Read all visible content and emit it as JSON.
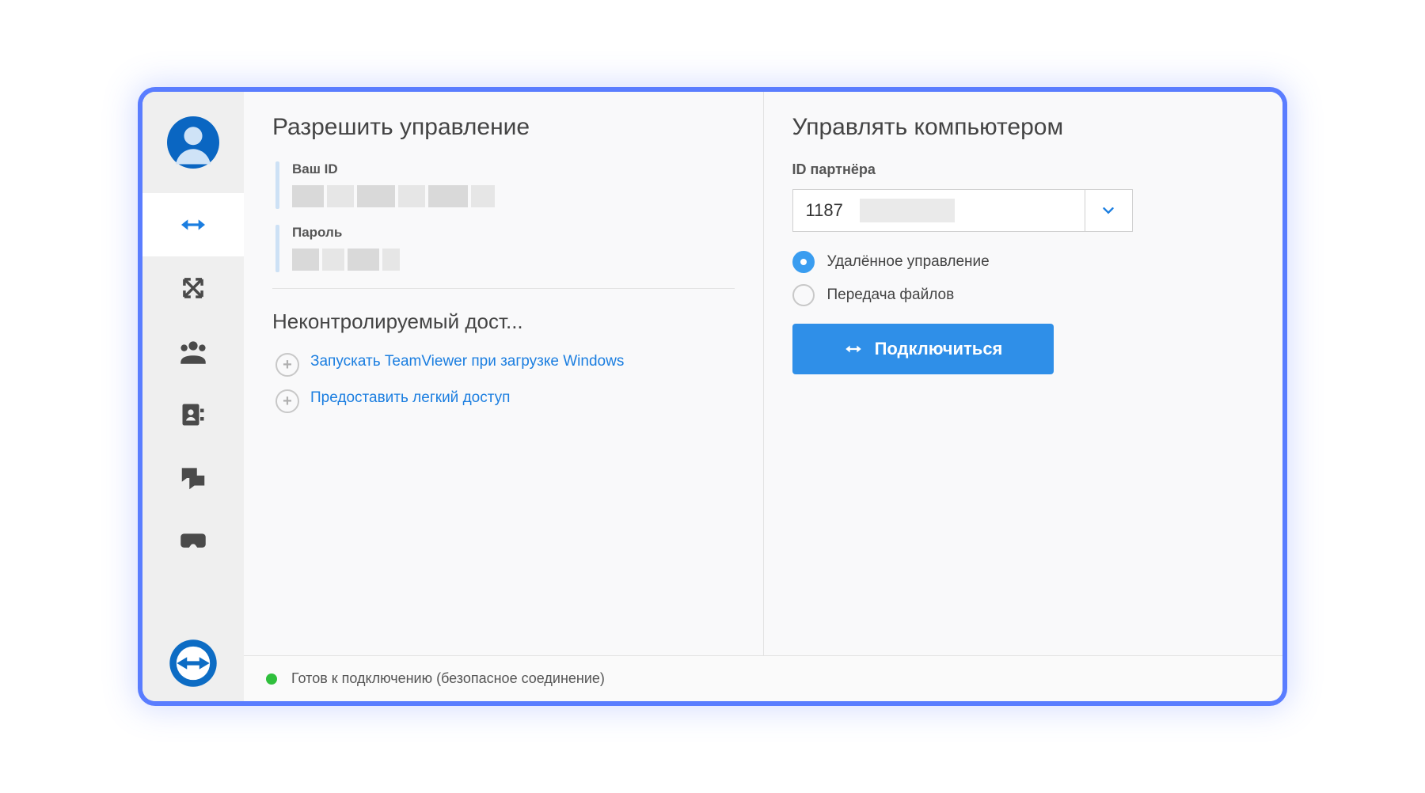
{
  "left": {
    "title": "Разрешить управление",
    "your_id_label": "Ваш ID",
    "password_label": "Пароль",
    "unattended_title": "Неконтролируемый дост...",
    "link_startup": "Запускать TeamViewer при загрузке Windows",
    "link_easy": "Предоставить легкий доступ"
  },
  "right": {
    "title": "Управлять компьютером",
    "partner_label": "ID партнёра",
    "partner_value": "1187",
    "radio_remote": "Удалённое управление",
    "radio_files": "Передача файлов",
    "connect": "Подключиться"
  },
  "status": "Готов к подключению (безопасное соединение)"
}
